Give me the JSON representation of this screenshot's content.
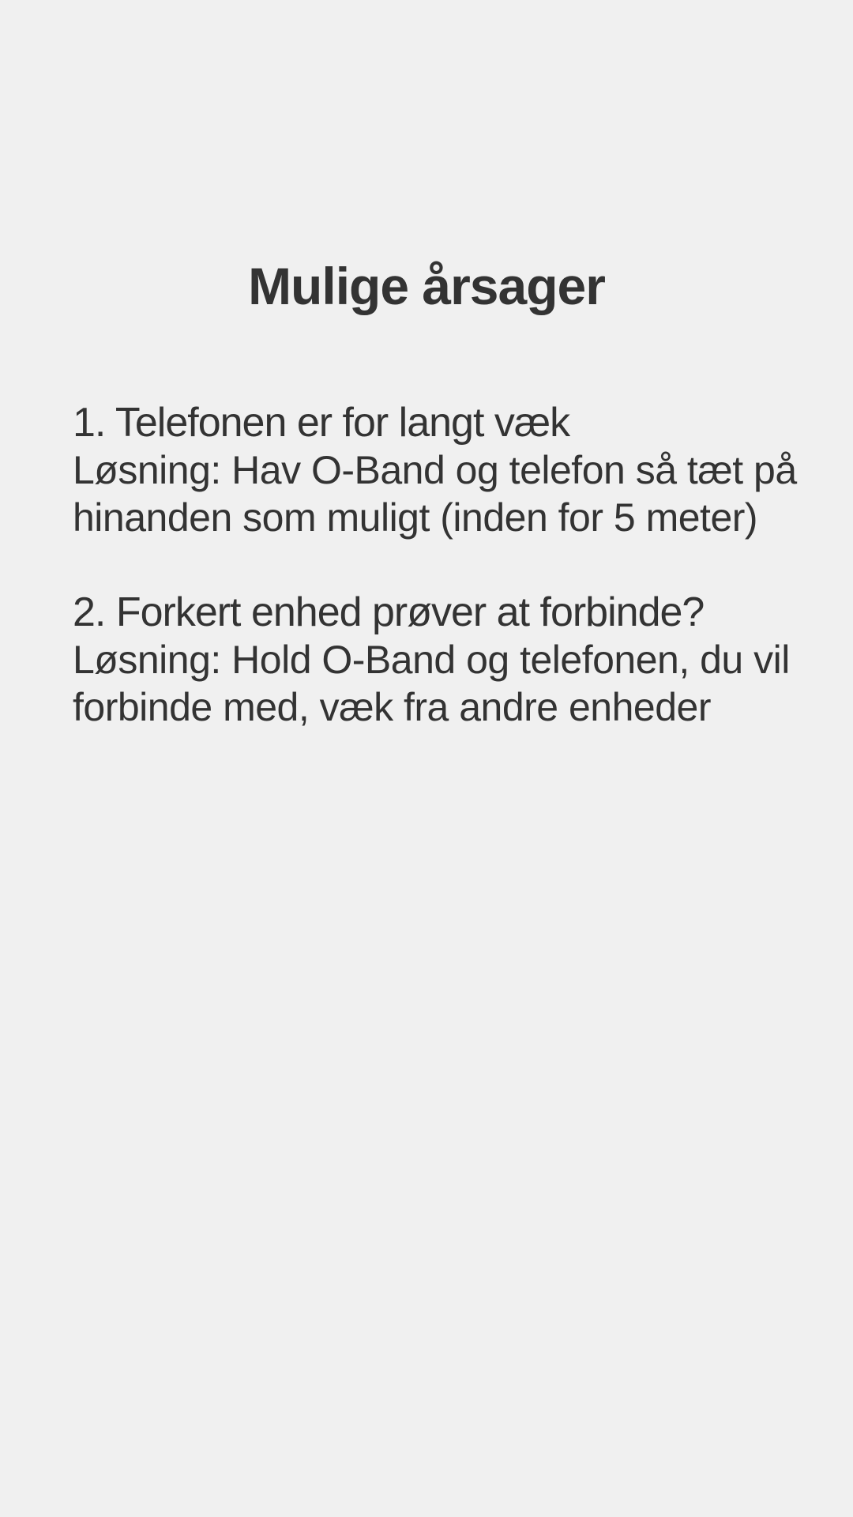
{
  "page": {
    "title": "Mulige årsager"
  },
  "causes": [
    {
      "heading": "1. Telefonen er for langt væk",
      "solution": "Løsning: Hav O-Band og telefon så tæt på hinanden som muligt (inden for 5 meter)"
    },
    {
      "heading": "2. Forkert enhed prøver at forbinde?",
      "solution": "Løsning:  Hold O-Band og telefonen, du vil forbinde med, væk fra andre enheder"
    }
  ],
  "colors": {
    "background": "#f0f0f0",
    "text": "#333333"
  }
}
